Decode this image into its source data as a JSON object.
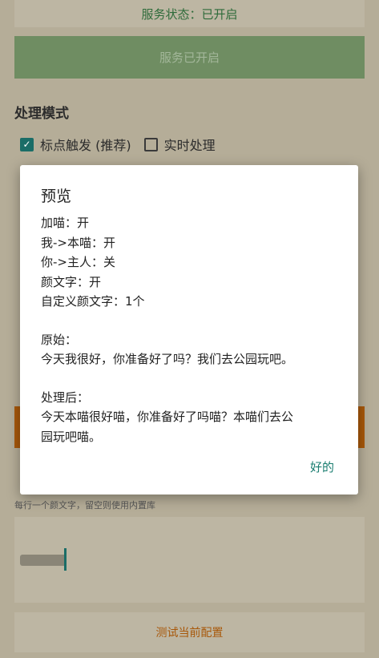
{
  "status": {
    "text": "服务状态：已开启",
    "button_label": "服务已开启"
  },
  "processing": {
    "title": "处理模式",
    "options": [
      {
        "label": "标点触发 (推荐)",
        "checked": true
      },
      {
        "label": "实时处理",
        "checked": false
      }
    ]
  },
  "emoticon": {
    "hint": "每行一个颜文字，留空则使用内置库"
  },
  "test_button": {
    "label": "测试当前配置"
  },
  "dialog": {
    "title": "预览",
    "settings": [
      "加喵：开",
      "我->本喵：开",
      "你->主人：关",
      "颜文字：开",
      "自定义颜文字：1个"
    ],
    "original_label": "原始：",
    "original_text": "今天我很好，你准备好了吗？我们去公园玩吧。",
    "processed_label": "处理后：",
    "processed_line1": "今天本喵很好喵，你准备好了吗喵？本喵们去公",
    "processed_line2": "园玩吧喵。",
    "ok_label": "好的"
  },
  "colors": {
    "accent": "#1a7d70",
    "warning": "#a8580a"
  }
}
